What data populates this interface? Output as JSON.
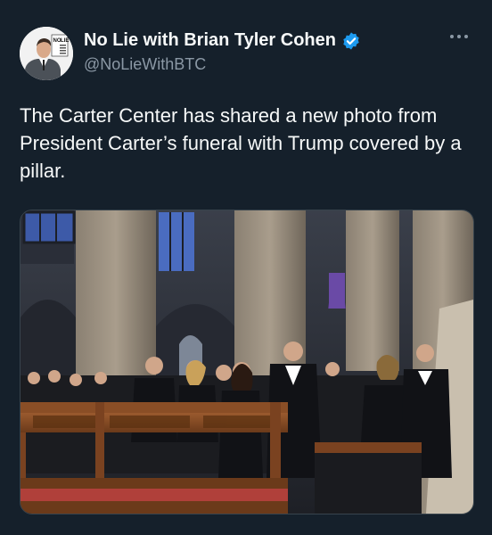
{
  "author": {
    "display_name": "No Lie with Brian Tyler Cohen",
    "handle": "@NoLieWithBTC",
    "avatar_logo_text": "NO LIE"
  },
  "icons": {
    "verified": "verified-badge-icon",
    "more": "more-options-icon"
  },
  "colors": {
    "background": "#15202b",
    "text_primary": "#f7f9f9",
    "text_secondary": "#8b98a5",
    "verified_blue": "#1d9bf0"
  },
  "tweet": {
    "text": "The Carter Center has shared a new photo from President Carter’s funeral with Trump covered by a pillar."
  },
  "media": {
    "type": "photo",
    "subject": "funeral-service-pews"
  }
}
